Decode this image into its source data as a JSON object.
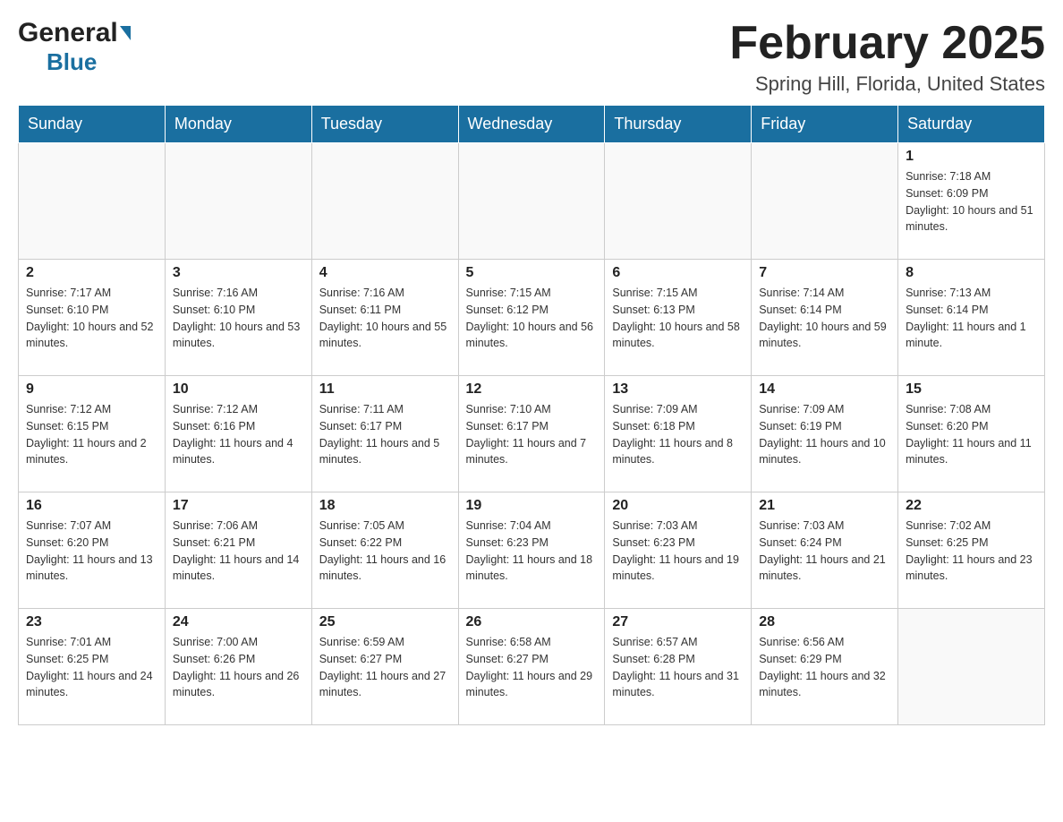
{
  "header": {
    "logo_general": "General",
    "logo_blue": "Blue",
    "title": "February 2025",
    "subtitle": "Spring Hill, Florida, United States"
  },
  "calendar": {
    "days_of_week": [
      "Sunday",
      "Monday",
      "Tuesday",
      "Wednesday",
      "Thursday",
      "Friday",
      "Saturday"
    ],
    "weeks": [
      [
        {
          "day": "",
          "info": ""
        },
        {
          "day": "",
          "info": ""
        },
        {
          "day": "",
          "info": ""
        },
        {
          "day": "",
          "info": ""
        },
        {
          "day": "",
          "info": ""
        },
        {
          "day": "",
          "info": ""
        },
        {
          "day": "1",
          "info": "Sunrise: 7:18 AM\nSunset: 6:09 PM\nDaylight: 10 hours and 51 minutes."
        }
      ],
      [
        {
          "day": "2",
          "info": "Sunrise: 7:17 AM\nSunset: 6:10 PM\nDaylight: 10 hours and 52 minutes."
        },
        {
          "day": "3",
          "info": "Sunrise: 7:16 AM\nSunset: 6:10 PM\nDaylight: 10 hours and 53 minutes."
        },
        {
          "day": "4",
          "info": "Sunrise: 7:16 AM\nSunset: 6:11 PM\nDaylight: 10 hours and 55 minutes."
        },
        {
          "day": "5",
          "info": "Sunrise: 7:15 AM\nSunset: 6:12 PM\nDaylight: 10 hours and 56 minutes."
        },
        {
          "day": "6",
          "info": "Sunrise: 7:15 AM\nSunset: 6:13 PM\nDaylight: 10 hours and 58 minutes."
        },
        {
          "day": "7",
          "info": "Sunrise: 7:14 AM\nSunset: 6:14 PM\nDaylight: 10 hours and 59 minutes."
        },
        {
          "day": "8",
          "info": "Sunrise: 7:13 AM\nSunset: 6:14 PM\nDaylight: 11 hours and 1 minute."
        }
      ],
      [
        {
          "day": "9",
          "info": "Sunrise: 7:12 AM\nSunset: 6:15 PM\nDaylight: 11 hours and 2 minutes."
        },
        {
          "day": "10",
          "info": "Sunrise: 7:12 AM\nSunset: 6:16 PM\nDaylight: 11 hours and 4 minutes."
        },
        {
          "day": "11",
          "info": "Sunrise: 7:11 AM\nSunset: 6:17 PM\nDaylight: 11 hours and 5 minutes."
        },
        {
          "day": "12",
          "info": "Sunrise: 7:10 AM\nSunset: 6:17 PM\nDaylight: 11 hours and 7 minutes."
        },
        {
          "day": "13",
          "info": "Sunrise: 7:09 AM\nSunset: 6:18 PM\nDaylight: 11 hours and 8 minutes."
        },
        {
          "day": "14",
          "info": "Sunrise: 7:09 AM\nSunset: 6:19 PM\nDaylight: 11 hours and 10 minutes."
        },
        {
          "day": "15",
          "info": "Sunrise: 7:08 AM\nSunset: 6:20 PM\nDaylight: 11 hours and 11 minutes."
        }
      ],
      [
        {
          "day": "16",
          "info": "Sunrise: 7:07 AM\nSunset: 6:20 PM\nDaylight: 11 hours and 13 minutes."
        },
        {
          "day": "17",
          "info": "Sunrise: 7:06 AM\nSunset: 6:21 PM\nDaylight: 11 hours and 14 minutes."
        },
        {
          "day": "18",
          "info": "Sunrise: 7:05 AM\nSunset: 6:22 PM\nDaylight: 11 hours and 16 minutes."
        },
        {
          "day": "19",
          "info": "Sunrise: 7:04 AM\nSunset: 6:23 PM\nDaylight: 11 hours and 18 minutes."
        },
        {
          "day": "20",
          "info": "Sunrise: 7:03 AM\nSunset: 6:23 PM\nDaylight: 11 hours and 19 minutes."
        },
        {
          "day": "21",
          "info": "Sunrise: 7:03 AM\nSunset: 6:24 PM\nDaylight: 11 hours and 21 minutes."
        },
        {
          "day": "22",
          "info": "Sunrise: 7:02 AM\nSunset: 6:25 PM\nDaylight: 11 hours and 23 minutes."
        }
      ],
      [
        {
          "day": "23",
          "info": "Sunrise: 7:01 AM\nSunset: 6:25 PM\nDaylight: 11 hours and 24 minutes."
        },
        {
          "day": "24",
          "info": "Sunrise: 7:00 AM\nSunset: 6:26 PM\nDaylight: 11 hours and 26 minutes."
        },
        {
          "day": "25",
          "info": "Sunrise: 6:59 AM\nSunset: 6:27 PM\nDaylight: 11 hours and 27 minutes."
        },
        {
          "day": "26",
          "info": "Sunrise: 6:58 AM\nSunset: 6:27 PM\nDaylight: 11 hours and 29 minutes."
        },
        {
          "day": "27",
          "info": "Sunrise: 6:57 AM\nSunset: 6:28 PM\nDaylight: 11 hours and 31 minutes."
        },
        {
          "day": "28",
          "info": "Sunrise: 6:56 AM\nSunset: 6:29 PM\nDaylight: 11 hours and 32 minutes."
        },
        {
          "day": "",
          "info": ""
        }
      ]
    ]
  }
}
